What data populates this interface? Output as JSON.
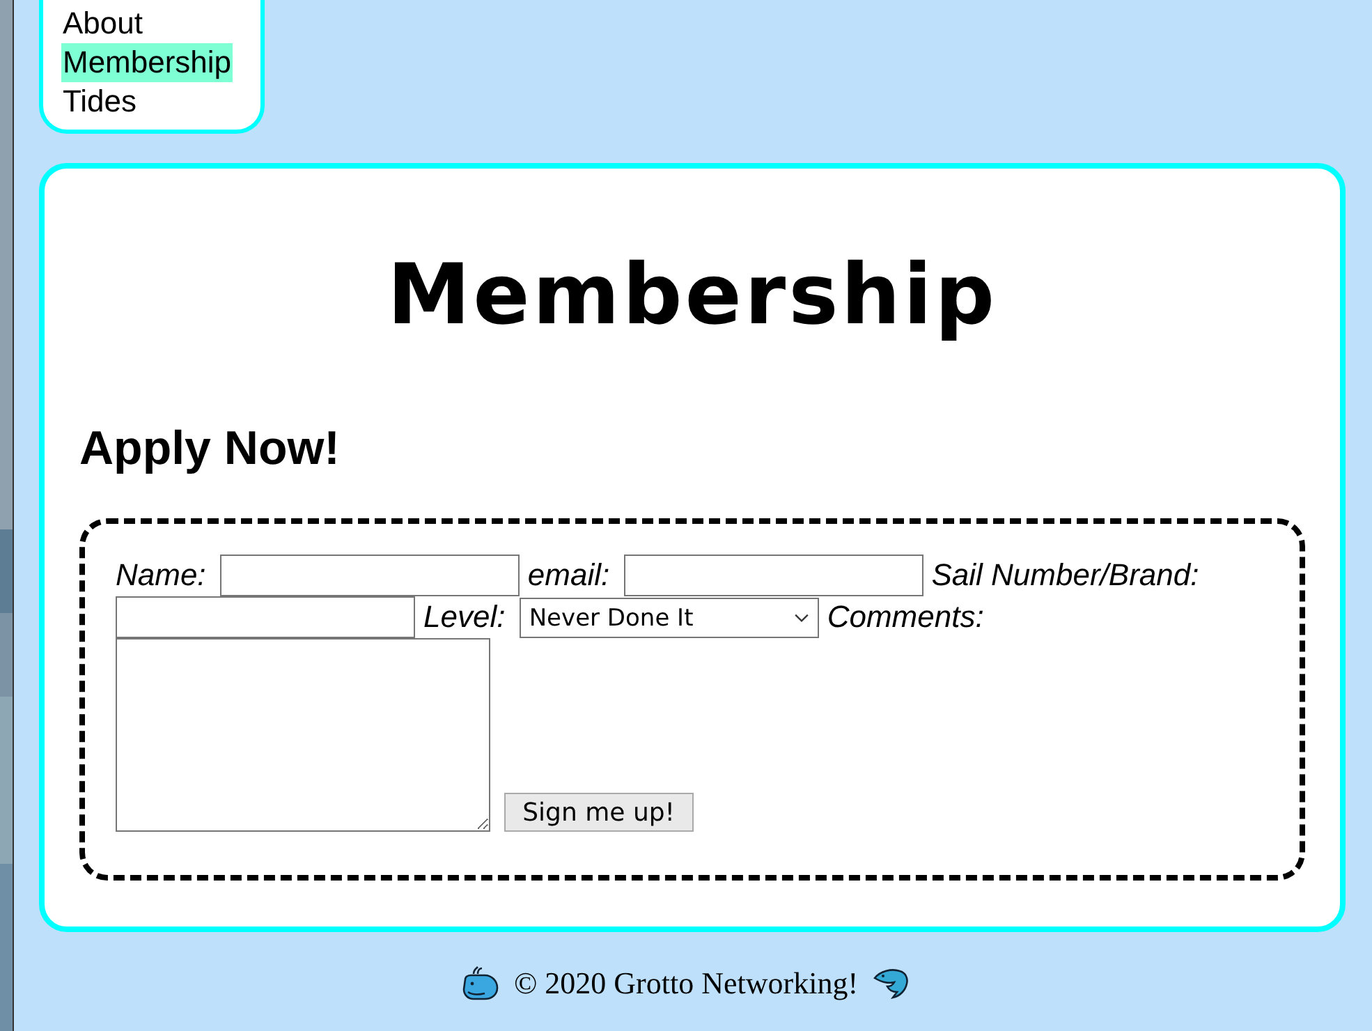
{
  "nav": {
    "items": [
      {
        "label": "About",
        "selected": false
      },
      {
        "label": "Membership",
        "selected": true
      },
      {
        "label": "Tides",
        "selected": false
      }
    ]
  },
  "page_title": "Membership",
  "form": {
    "heading": "Apply Now!",
    "fields": [
      {
        "kind": "text",
        "label": "Name:"
      },
      {
        "kind": "text",
        "label": "email:"
      },
      {
        "kind": "text",
        "label": "Sail Number/Brand:"
      },
      {
        "kind": "select",
        "label": "Level:",
        "value": "Never Done It"
      },
      {
        "kind": "textarea",
        "label": "Comments:"
      }
    ],
    "button": "Sign me up!"
  },
  "footer": {
    "text": "© 2020 Grotto Networking!"
  }
}
